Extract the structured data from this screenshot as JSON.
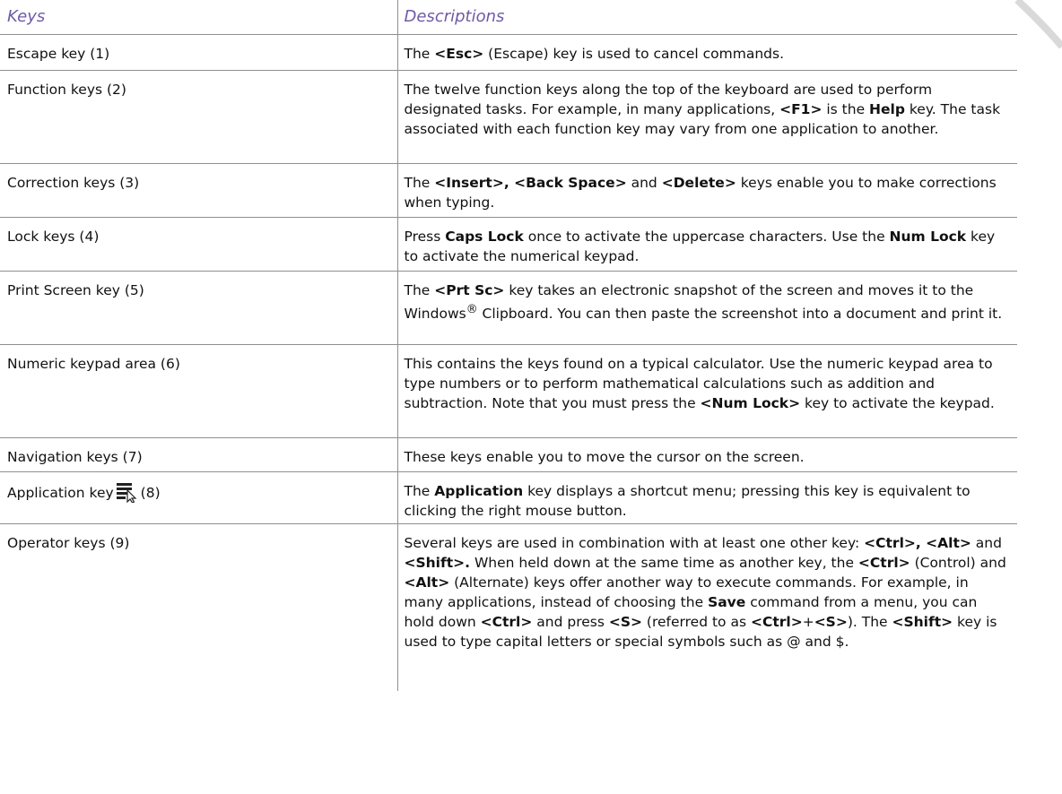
{
  "header": {
    "keys": "Keys",
    "descriptions": "Descriptions"
  },
  "rows": [
    {
      "key": "Escape key (1)",
      "desc": [
        "The ",
        {
          "b": "<Esc>"
        },
        " (Escape) key is used to cancel commands."
      ]
    },
    {
      "key": "Function keys (2)",
      "desc": [
        "The twelve function keys along the top of the keyboard are used to perform designated tasks. For example, in many applications, ",
        {
          "b": "<F1>"
        },
        " is the ",
        {
          "b": "Help"
        },
        " key. The task associated with each function key may vary from one application to another."
      ]
    },
    {
      "key": "Correction keys (3)",
      "desc": [
        "The ",
        {
          "b": "<Insert>, <Back Space>"
        },
        " and ",
        {
          "b": "<Delete>"
        },
        " keys enable you to make corrections when typing."
      ]
    },
    {
      "key": "Lock keys (4)",
      "desc": [
        "Press ",
        {
          "b": "Caps Lock"
        },
        " once to activate the uppercase characters. Use the ",
        {
          "b": "Num Lock"
        },
        " key to activate the numerical keypad."
      ]
    },
    {
      "key": "Print Screen key (5)",
      "desc": [
        "The ",
        {
          "b": "<Prt Sc>"
        },
        " key takes an electronic snapshot of the screen and moves it to the Windows",
        {
          "sup": "®"
        },
        " Clipboard. You can then paste the screenshot into a document and print it."
      ]
    },
    {
      "key": "Numeric keypad area (6)",
      "desc": [
        "This contains the keys found on a typical calculator. Use the numeric keypad area to type numbers or to perform mathematical calculations such as addition and subtraction. Note that you must press the ",
        {
          "b": "<Num Lock>"
        },
        " key to activate the keypad."
      ]
    },
    {
      "key": "Navigation keys (7)",
      "desc": [
        "These keys enable you to move the cursor on the screen."
      ]
    },
    {
      "key": "Application key",
      "key_suffix": "(8)",
      "icon": "application-menu-key-icon",
      "desc": [
        "The ",
        {
          "b": "Application"
        },
        " key displays a shortcut menu; pressing this key is equivalent to clicking the right mouse button."
      ]
    },
    {
      "key": "Operator keys (9)",
      "desc": [
        "Several keys are used in combination with at least one other key: ",
        {
          "b": "<Ctrl>, <Alt>"
        },
        " and ",
        {
          "b": "<Shift>."
        },
        " When held down at the same time as another key, the ",
        {
          "b": "<Ctrl>"
        },
        " (Control) and ",
        {
          "b": "<Alt>"
        },
        " (Alternate) keys offer another way to execute commands. For example, in many applications, instead of choosing the ",
        {
          "b": "Save"
        },
        " command from a menu, you can hold down ",
        {
          "b": "<Ctrl>"
        },
        " and press ",
        {
          "b": "<S>"
        },
        " (referred to as ",
        {
          "b": "<Ctrl>"
        },
        "+",
        {
          "b": "<S>"
        },
        "). The ",
        {
          "b": "<Shift>"
        },
        " key is used to type capital letters or special symbols such as @ and $."
      ]
    }
  ],
  "colors": {
    "header_text": "#6f5aa8",
    "rule": "#8f8f8f",
    "corner_arc": "#d9d9d9"
  }
}
